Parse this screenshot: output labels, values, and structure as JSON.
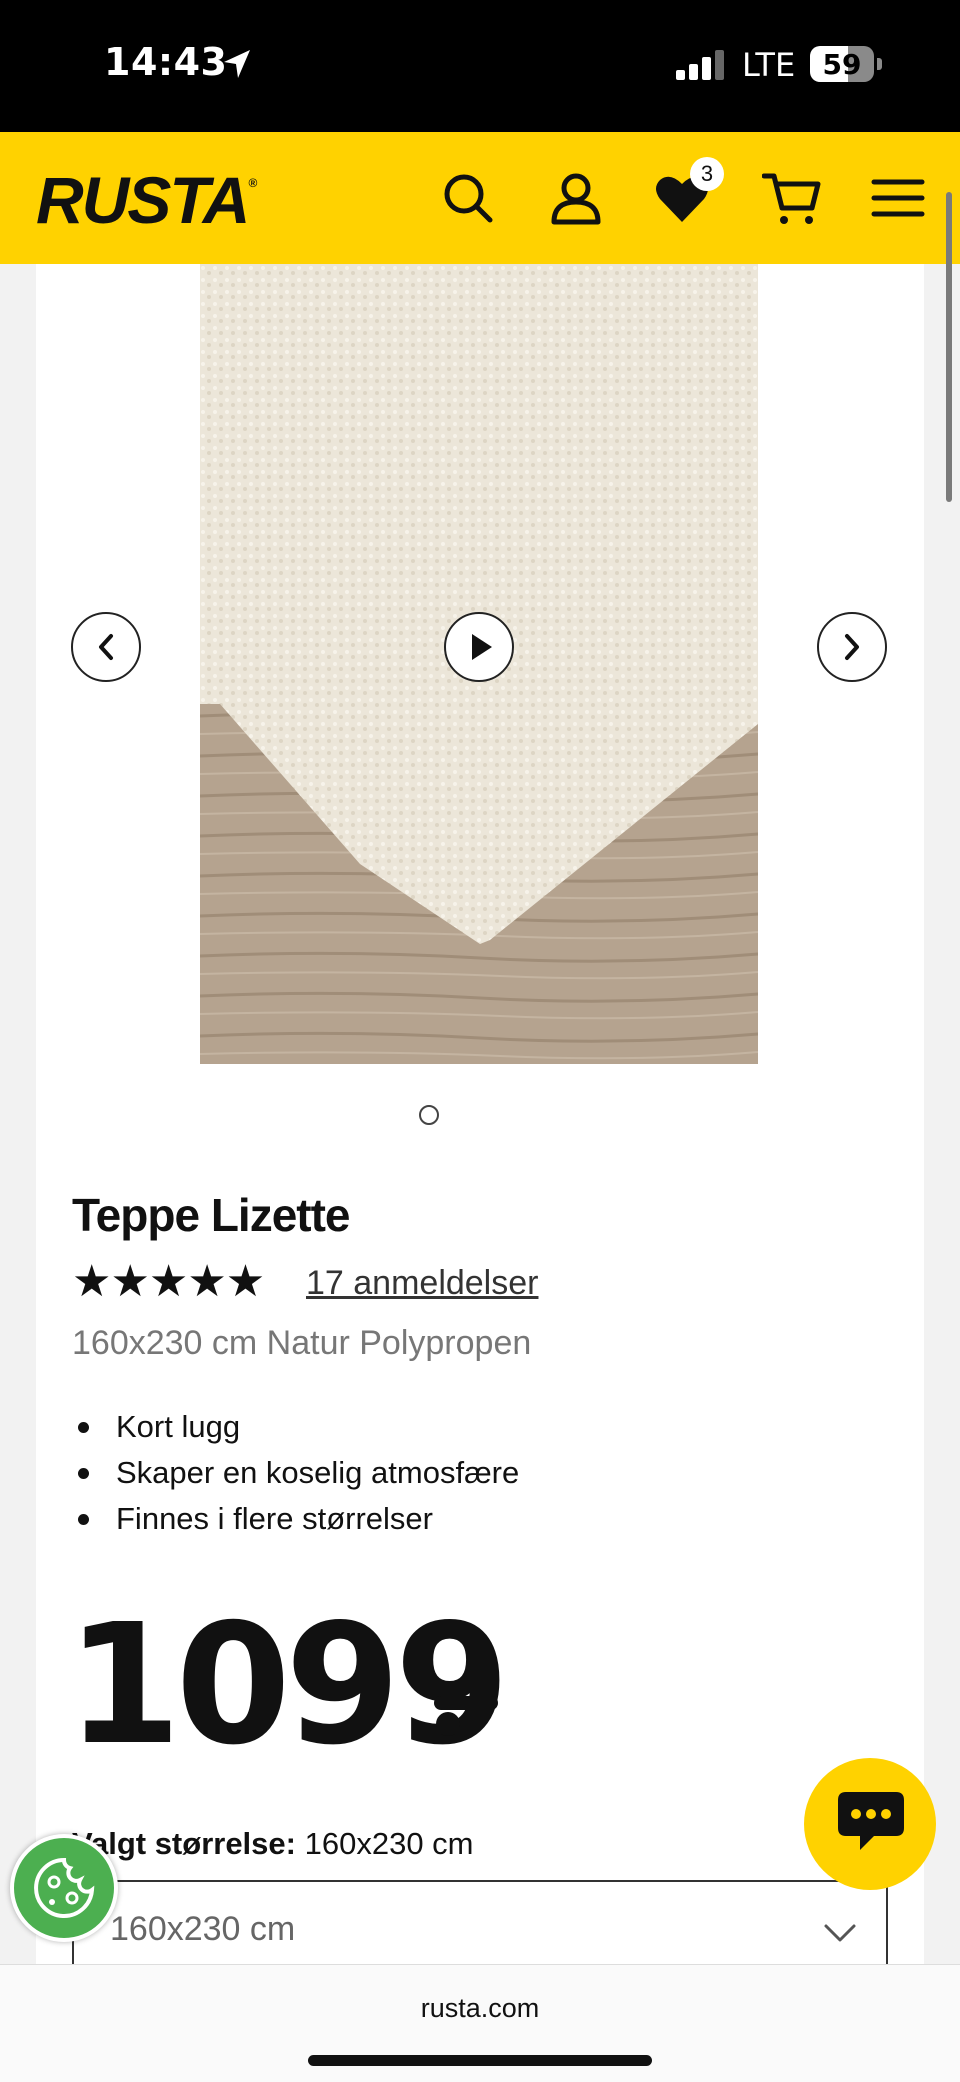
{
  "status_bar": {
    "time": "14:43",
    "network": "LTE",
    "battery": "59",
    "battery_level": 0.59
  },
  "header": {
    "logo": "RUSTA",
    "logo_mark": "®",
    "wishlist_count": "3",
    "brand_color": "#ffd200"
  },
  "gallery": {
    "image_count": 1,
    "active_index": 0
  },
  "product": {
    "title": "Teppe Lizette",
    "stars": "★★★★★",
    "rating": 5,
    "reviews": "17 anmeldelser",
    "subtitle": "160x230 cm Natur Polypropen",
    "features": [
      "Kort lugg",
      "Skaper en koselig atmosfære",
      "Finnes i flere størrelser"
    ],
    "price": "1099"
  },
  "size": {
    "label": "Valgt størrelse:",
    "value": "160x230 cm",
    "selected": "160x230 cm"
  },
  "browser": {
    "url": "rusta.com"
  }
}
